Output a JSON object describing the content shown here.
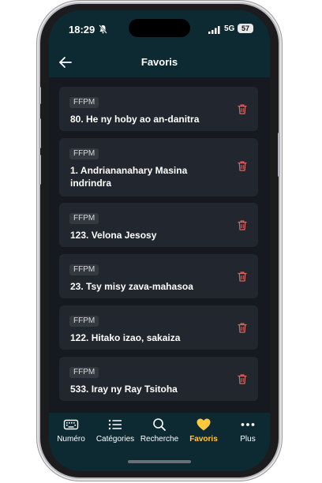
{
  "status": {
    "time": "18:29",
    "network": "5G",
    "battery": "57"
  },
  "header": {
    "title": "Favoris"
  },
  "favorites": [
    {
      "tag": "FFPM",
      "title": "80. He ny hoby ao an-danitra"
    },
    {
      "tag": "FFPM",
      "title": "1. Andriananahary Masina indrindra"
    },
    {
      "tag": "FFPM",
      "title": "123. Velona Jesosy"
    },
    {
      "tag": "FFPM",
      "title": "23. Tsy misy zava-mahasoa"
    },
    {
      "tag": "FFPM",
      "title": "122. Hitako izao, sakaiza"
    },
    {
      "tag": "FFPM",
      "title": "533. Iray ny Ray Tsitoha"
    }
  ],
  "tabs": [
    {
      "label": "Numéro",
      "icon": "keyboard-icon"
    },
    {
      "label": "Catégories",
      "icon": "list-icon"
    },
    {
      "label": "Recherche",
      "icon": "search-icon"
    },
    {
      "label": "Favoris",
      "icon": "heart-icon",
      "active": true
    },
    {
      "label": "Plus",
      "icon": "more-icon"
    }
  ],
  "colors": {
    "header_bg": "#0d2a33",
    "screen_bg": "#161a20",
    "card_bg": "#22262e",
    "accent": "#ffc83d",
    "delete": "#e0635c"
  }
}
